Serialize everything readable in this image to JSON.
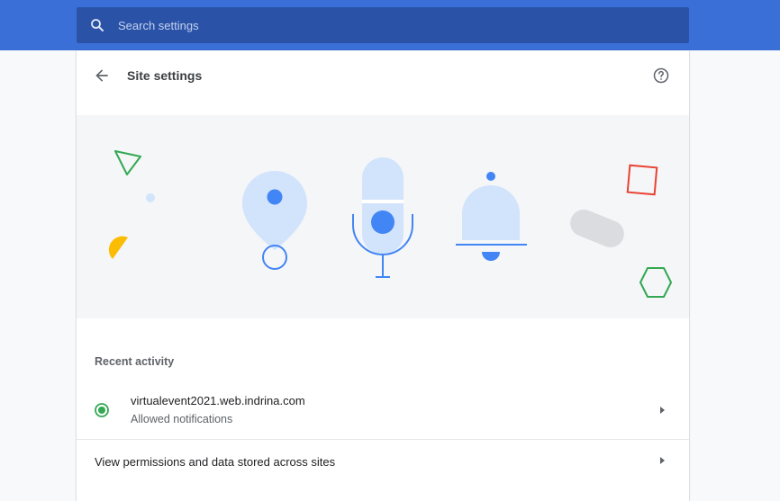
{
  "search": {
    "placeholder": "Search settings"
  },
  "header": {
    "title": "Site settings"
  },
  "recent_activity": {
    "title": "Recent activity",
    "items": [
      {
        "site": "virtualevent2021.web.indrina.com",
        "status": "Allowed notifications"
      }
    ]
  },
  "permissions_link": {
    "label": "View permissions and data stored across sites"
  },
  "colors": {
    "topbar": "#3b6fd8",
    "search_bg": "#2a53a8",
    "accent_blue": "#4285f4",
    "light_blue": "#d2e3fc",
    "green": "#34a853",
    "red": "#ea4335",
    "yellow": "#fbbc04",
    "grey": "#dadce0"
  },
  "icons": [
    "search-icon",
    "back-arrow-icon",
    "help-icon",
    "status-dot-icon",
    "chevron-right-icon"
  ]
}
